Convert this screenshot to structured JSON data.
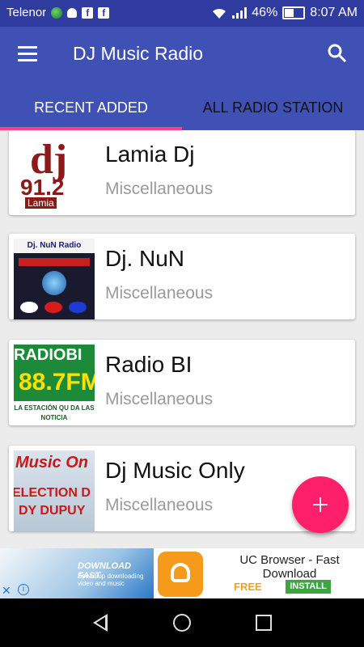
{
  "status_bar": {
    "carrier": "Telenor",
    "battery_percent": "46%",
    "time": "8:07 AM",
    "icons": [
      "globe-icon",
      "android-icon",
      "facebook-icon",
      "facebook-icon",
      "wifi-icon",
      "signal-icon",
      "battery-icon"
    ]
  },
  "app_bar": {
    "title": "DJ Music Radio",
    "menu_icon": "menu-icon",
    "search_icon": "search-icon"
  },
  "tabs": [
    {
      "label": "RECENT ADDED",
      "selected": true
    },
    {
      "label": "ALL RADIO STATION",
      "selected": false
    }
  ],
  "stations": [
    {
      "name": "Lamia Dj",
      "category": "Miscellaneous",
      "thumb": {
        "line1": "dj",
        "line2": "91.2",
        "line3": "Lamia"
      }
    },
    {
      "name": "Dj. NuN",
      "category": "Miscellaneous",
      "thumb": {
        "line1": "Dj. NuN Radio"
      }
    },
    {
      "name": "Radio BI",
      "category": "Miscellaneous",
      "thumb": {
        "line1": "RADIOBI",
        "line2": "88.7FM",
        "line3": "LA ESTACIÓN QU DA LAS NOTICIA"
      }
    },
    {
      "name": "Dj Music Only",
      "category": "Miscellaneous",
      "thumb": {
        "line1": "Music On",
        "line2": "ELECTION D",
        "line3": "DY DUPUY"
      }
    }
  ],
  "fab": {
    "icon": "plus-icon",
    "color": "#ff1f6b"
  },
  "ad": {
    "title": "UC Browser - Fast Download",
    "price": "FREE",
    "cta": "INSTALL",
    "banner_text": "DOWNLOAD FAST",
    "banner_subtext": "Speed up downloading video and music",
    "close_icon": "close-icon",
    "info_icon": "info-icon"
  },
  "colors": {
    "primary": "#3f51b5",
    "status_bar": "#2f3b9e",
    "accent": "#ff4081"
  }
}
